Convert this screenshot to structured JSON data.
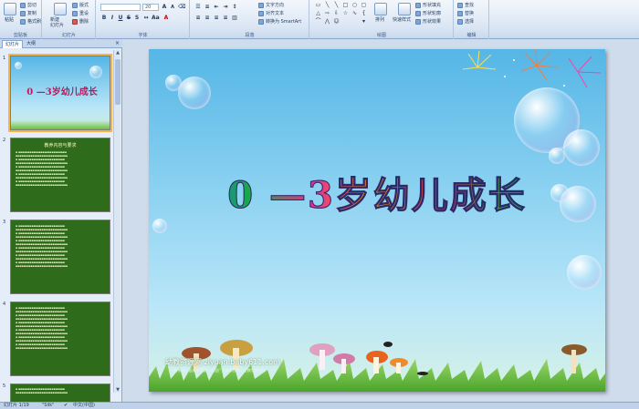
{
  "ribbon": {
    "clipboard": {
      "paste": "粘贴",
      "cut": "剪切",
      "copy": "复制",
      "format_painter": "格式刷",
      "label": "剪贴板"
    },
    "slides": {
      "new_slide": "新建\n幻灯片",
      "layout": "版式",
      "reset": "重设",
      "delete": "删除",
      "label": "幻灯片"
    },
    "font": {
      "font_name": "",
      "font_size": "20",
      "label": "字体"
    },
    "paragraph": {
      "text_direction": "文字方向",
      "align_text": "对齐文本",
      "smartart": "转换为 SmartArt",
      "label": "段落"
    },
    "drawing": {
      "arrange": "排列",
      "quick_styles": "快速样式",
      "shape_fill": "形状填充",
      "shape_outline": "形状轮廓",
      "shape_effects": "形状效果",
      "label": "绘图"
    },
    "editing": {
      "find": "查找",
      "replace": "替换",
      "select": "选择",
      "label": "编辑"
    }
  },
  "panel": {
    "tab_slides": "幻灯片",
    "tab_outline": "大纲",
    "thumbnails": [
      {
        "number": "1",
        "title": "0 —3岁幼儿成长"
      },
      {
        "number": "2",
        "title": "教养内容与要求"
      },
      {
        "number": "3",
        "title": ""
      },
      {
        "number": "4",
        "title": ""
      },
      {
        "number": "5",
        "title": ""
      }
    ]
  },
  "slide": {
    "title": "0 —3岁幼儿成长",
    "watermark": "幼教资源网 ziyuan.baby611.com",
    "watermark_sub": "与好教师一起分享资源 | 欢迎广大教师投稿 | 让教学更快乐"
  },
  "status": {
    "slide_counter": "幻灯片 1/19",
    "theme": "\"Silk\"",
    "language": "中文(中国)"
  },
  "colors": {
    "ribbon_bg": "#dbe6f4",
    "slide_sky": "#55b6e6",
    "thumb_green": "#2e6b1a",
    "selection": "#f7b44a"
  }
}
